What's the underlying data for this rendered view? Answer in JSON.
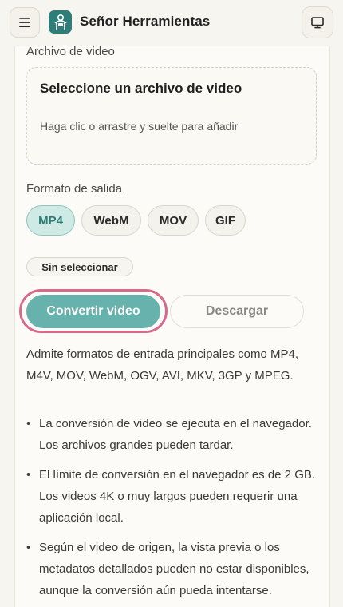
{
  "header": {
    "title": "Señor Herramientas",
    "menu_icon": "hamburger-menu-icon",
    "logo_icon": "tool-mascot-icon",
    "display_icon": "monitor-icon"
  },
  "upload": {
    "label": "Archivo de video",
    "dropzone_title": "Seleccione un archivo de video",
    "dropzone_hint": "Haga clic o arrastre y suelte para añadir"
  },
  "output": {
    "label": "Formato de salida",
    "formats": [
      "MP4",
      "WebM",
      "MOV",
      "GIF"
    ],
    "selected": "MP4"
  },
  "status": "Sin seleccionar",
  "actions": {
    "convert": "Convertir video",
    "download": "Descargar"
  },
  "info": {
    "supported": "Admite formatos de entrada principales como MP4, M4V, MOV, WebM, OGV, AVI, MKV, 3GP y MPEG.",
    "notes": [
      "La conversión de video se ejecuta en el navegador. Los archivos grandes pueden tardar.",
      "El límite de conversión en el navegador es de 2 GB. Los videos 4K o muy largos pueden requerir una aplicación local.",
      "Según el video de origen, la vista previa o los metadatos detallados pueden no estar disponibles, aunque la conversión aún pueda intentarse."
    ]
  },
  "colors": {
    "accent": "#67b2ad",
    "selected_chip": "#cfe9e5",
    "highlight_ring": "#d6698c"
  }
}
